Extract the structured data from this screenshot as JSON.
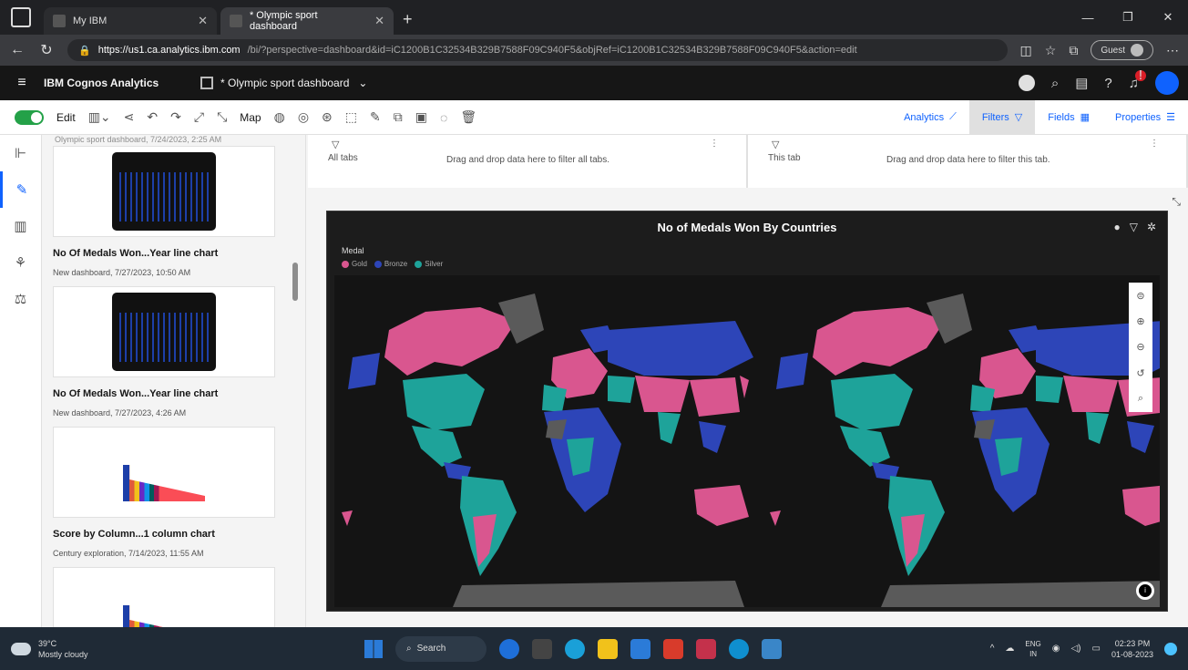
{
  "browser": {
    "tabs": [
      {
        "label": "My IBM"
      },
      {
        "label": "* Olympic sport dashboard"
      }
    ],
    "url_host": "https://us1.ca.analytics.ibm.com",
    "url_rest": "/bi/?perspective=dashboard&id=iC1200B1C32534B329B7588F09C940F5&objRef=iC1200B1C32534B329B7588F09C940F5&action=edit",
    "guest_label": "Guest"
  },
  "app": {
    "brand": "IBM Cognos Analytics",
    "dashboard_title": "* Olympic sport dashboard"
  },
  "toolbar": {
    "edit_label": "Edit",
    "map_label": "Map",
    "tabs": [
      {
        "label": "Analytics"
      },
      {
        "label": "Filters"
      },
      {
        "label": "Fields"
      },
      {
        "label": "Properties"
      }
    ]
  },
  "panel": {
    "cut_text": "Olympic sport dashboard, 7/24/2023, 2:25 AM",
    "snapshots": [
      {
        "title": "No Of Medals Won...Year line chart",
        "subtitle": "New dashboard, 7/27/2023, 10:50 AM"
      },
      {
        "title": "No Of Medals Won...Year line chart",
        "subtitle": "New dashboard, 7/27/2023, 4:26 AM"
      },
      {
        "title": "Score by Column...1 column chart",
        "subtitle": "Century exploration, 7/14/2023, 11:55 AM"
      }
    ]
  },
  "filters": {
    "all_tabs_label": "All tabs",
    "all_tabs_hint": "Drag and drop data here to filter all tabs.",
    "this_tab_label": "This tab",
    "this_tab_hint": "Drag and drop data here to filter this tab."
  },
  "widget": {
    "title": "No of Medals Won By Countries",
    "legend_title": "Medal",
    "legend_items": [
      {
        "label": "Gold",
        "color": "#d9568f"
      },
      {
        "label": "Bronze",
        "color": "#2d45b8"
      },
      {
        "label": "Silver",
        "color": "#1ea39a"
      }
    ]
  },
  "taskbar": {
    "temp": "39°C",
    "weather": "Mostly cloudy",
    "search_label": "Search",
    "lang_top": "ENG",
    "lang_bottom": "IN",
    "time": "02:23 PM",
    "date": "01-08-2023"
  },
  "colors": {
    "gold": "#d9568f",
    "bronze": "#2d45b8",
    "silver": "#1ea39a",
    "no_data": "#5a5a5a",
    "accent": "#0f62fe"
  }
}
